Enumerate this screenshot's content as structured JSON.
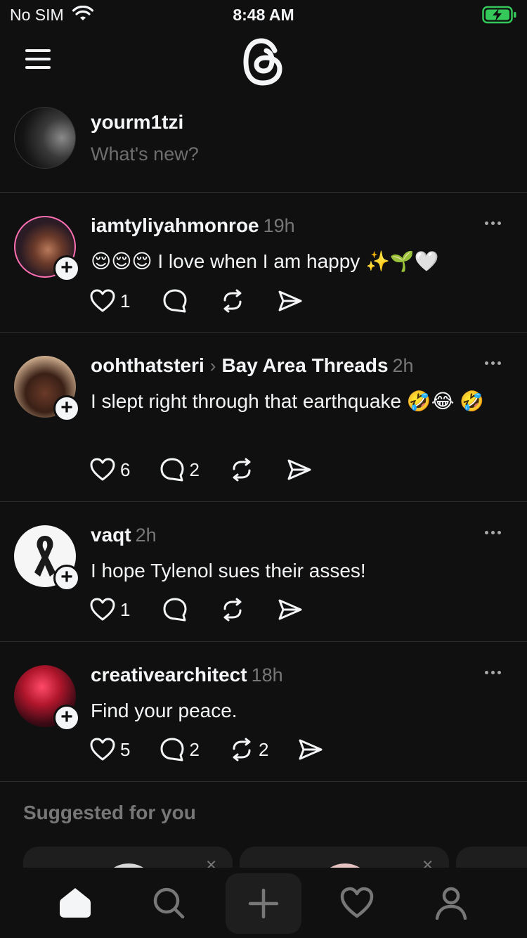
{
  "status_bar": {
    "carrier": "No SIM",
    "time": "8:48 AM",
    "battery_color": "#34c759"
  },
  "header": {
    "logo": "threads-logo-icon",
    "menu": "menu-icon"
  },
  "composer": {
    "username": "yourm1tzi",
    "placeholder": "What's new?"
  },
  "posts": [
    {
      "username": "iamtyliyahmonroe",
      "time": "19h",
      "text": "😌😌😌 I love when I am happy ✨🌱🤍",
      "likes": "1",
      "replies": "",
      "reposts": ""
    },
    {
      "username": "oohthatsteri",
      "community": "Bay Area Threads",
      "time": "2h",
      "text": "I slept right through that earthquake 🤣😂 🤣",
      "likes": "6",
      "replies": "2",
      "reposts": ""
    },
    {
      "username": "vaqt",
      "time": "2h",
      "text": "I hope Tylenol sues their asses!",
      "likes": "1",
      "replies": "",
      "reposts": ""
    },
    {
      "username": "creativearchitect",
      "time": "18h",
      "text": "Find your peace.",
      "likes": "5",
      "replies": "2",
      "reposts": "2"
    }
  ],
  "suggested": {
    "title": "Suggested for you"
  },
  "tabbar": [
    "home-icon",
    "search-icon",
    "new-post-icon",
    "activity-heart-icon",
    "profile-icon"
  ]
}
